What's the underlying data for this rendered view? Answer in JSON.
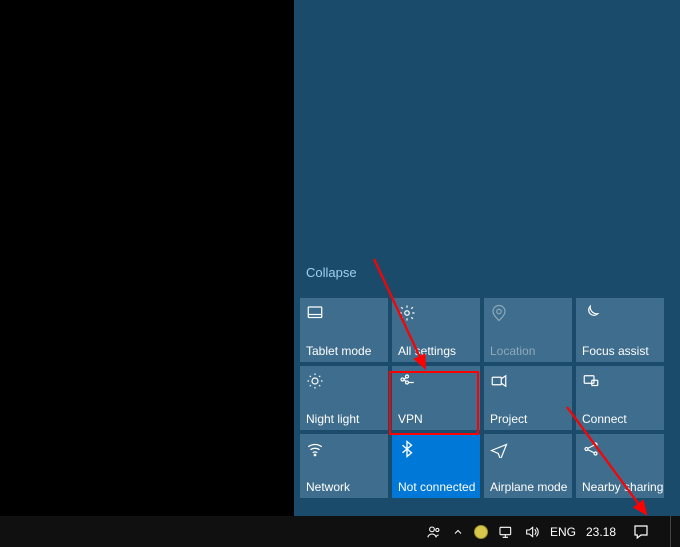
{
  "action_center": {
    "collapse_label": "Collapse",
    "tiles": [
      {
        "id": "tablet-mode",
        "label": "Tablet mode",
        "icon": "tablet",
        "state": "normal"
      },
      {
        "id": "all-settings",
        "label": "All settings",
        "icon": "gear",
        "state": "normal"
      },
      {
        "id": "location",
        "label": "Location",
        "icon": "location",
        "state": "disabled"
      },
      {
        "id": "focus-assist",
        "label": "Focus assist",
        "icon": "moon",
        "state": "normal"
      },
      {
        "id": "night-light",
        "label": "Night light",
        "icon": "sun",
        "state": "normal"
      },
      {
        "id": "vpn",
        "label": "VPN",
        "icon": "vpn",
        "state": "normal"
      },
      {
        "id": "project",
        "label": "Project",
        "icon": "project",
        "state": "normal"
      },
      {
        "id": "connect",
        "label": "Connect",
        "icon": "connect",
        "state": "normal"
      },
      {
        "id": "network",
        "label": "Network",
        "icon": "wifi",
        "state": "normal"
      },
      {
        "id": "bluetooth",
        "label": "Not connected",
        "icon": "bluetooth",
        "state": "active"
      },
      {
        "id": "airplane-mode",
        "label": "Airplane mode",
        "icon": "airplane",
        "state": "normal"
      },
      {
        "id": "nearby-sharing",
        "label": "Nearby sharing",
        "icon": "share",
        "state": "normal"
      }
    ]
  },
  "annotations": {
    "highlighted_tile": "vpn",
    "highlighted_taskbar_button": "action-center"
  },
  "taskbar": {
    "language": "ENG",
    "clock": "23.18"
  },
  "icons": {
    "tablet": "<svg viewBox='0 0 24 24' width='18' height='18' fill='none' stroke='currentColor' stroke-width='1.6'><rect x='3' y='4' width='18' height='14' rx='1'/><line x1='3' y1='14' x2='21' y2='14'/></svg>",
    "gear": "<svg viewBox='0 0 24 24' width='18' height='18' fill='none' stroke='currentColor' stroke-width='1.6'><circle cx='12' cy='12' r='3'/><path d='M12 2v3M12 19v3M4.2 4.2l2.1 2.1M17.7 17.7l2.1 2.1M2 12h3M19 12h3M4.2 19.8l2.1-2.1M17.7 6.3l2.1-2.1'/></svg>",
    "location": "<svg viewBox='0 0 24 24' width='18' height='18' fill='none' stroke='currentColor' stroke-width='1.6'><circle cx='12' cy='10' r='3'/><path d='M12 2a8 8 0 0 1 8 8c0 5-8 12-8 12S4 15 4 10a8 8 0 0 1 8-8z'/></svg>",
    "moon": "<svg viewBox='0 0 24 24' width='18' height='18' fill='none' stroke='currentColor' stroke-width='1.6'><path d='M21 13A9 9 0 0 1 11 3a7 7 0 1 0 10 10z'/></svg>",
    "sun": "<svg viewBox='0 0 24 24' width='18' height='18' fill='none' stroke='currentColor' stroke-width='1.6'><circle cx='12' cy='12' r='4'/><path d='M12 2v2M12 20v2M4 12H2M22 12h-2M5 5l1.5 1.5M17.5 17.5L19 19M5 19l1.5-1.5M17.5 6.5L19 5'/></svg>",
    "vpn": "<svg viewBox='0 0 24 24' width='18' height='18' fill='none' stroke='currentColor' stroke-width='1.6'><circle cx='6' cy='10' r='2'/><circle cx='12' cy='6' r='2'/><circle cx='12' cy='14' r='2'/><path d='M8 10l3-3M8 10l3 3M14 14h7'/></svg>",
    "project": "<svg viewBox='0 0 24 24' width='18' height='18' fill='none' stroke='currentColor' stroke-width='1.6'><rect x='3' y='7' width='12' height='10' rx='1'/><path d='M15 9l6-4v14l-6-4'/></svg>",
    "connect": "<svg viewBox='0 0 24 24' width='18' height='18' fill='none' stroke='currentColor' stroke-width='1.6'><rect x='3' y='5' width='13' height='10' rx='1'/><rect x='13' y='11' width='8' height='7' rx='1'/></svg>",
    "wifi": "<svg viewBox='0 0 24 24' width='18' height='18' fill='none' stroke='currentColor' stroke-width='1.6'><path d='M3 9a15 15 0 0 1 18 0'/><path d='M6 13a10 10 0 0 1 12 0'/><path d='M9 17a5 5 0 0 1 6 0'/><circle cx='12' cy='20' r='1' fill='currentColor'/></svg>",
    "bluetooth": "<svg viewBox='0 0 24 24' width='18' height='18' fill='none' stroke='currentColor' stroke-width='1.8'><path d='M12 2l6 5-6 5 6 5-6 5V2zM6 7l12 10M6 17L18 7'/></svg>",
    "airplane": "<svg viewBox='0 0 24 24' width='18' height='18' fill='none' stroke='currentColor' stroke-width='1.6'><path d='M2 14l20-8-8 20-3-8-9-4z'/></svg>",
    "share": "<svg viewBox='0 0 24 24' width='18' height='18' fill='none' stroke='currentColor' stroke-width='1.6'><circle cx='6' cy='12' r='2'/><circle cx='18' cy='6' r='2'/><circle cx='18' cy='18' r='2'/><path d='M8 11l8-4M8 13l8 4'/></svg>"
  }
}
